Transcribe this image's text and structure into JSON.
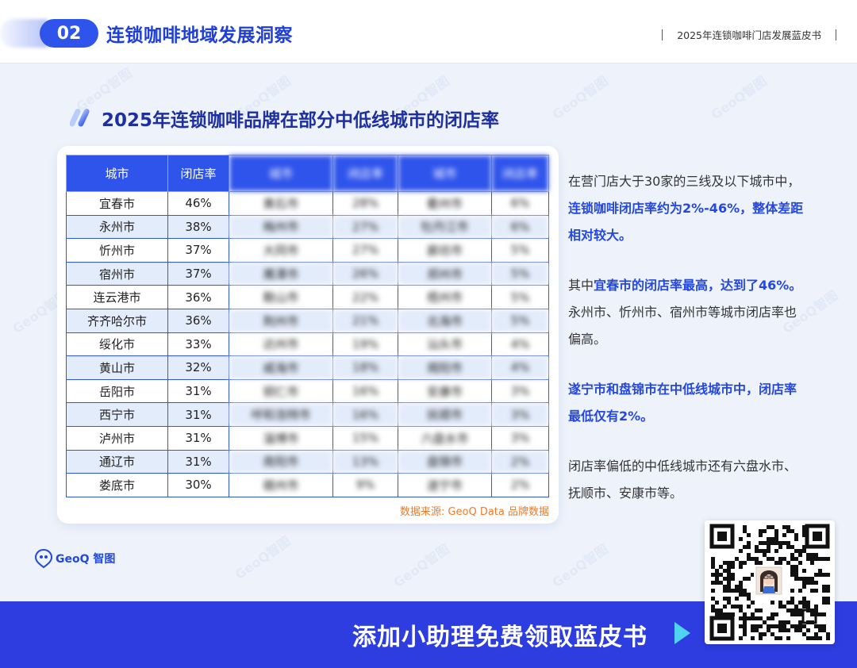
{
  "header": {
    "section_number": "02",
    "section_title": "连锁咖啡地域发展洞察",
    "report_title": "2025年连锁咖啡门店发展蓝皮书"
  },
  "section": {
    "title": "2025年连锁咖啡品牌在部分中低线城市的闭店率"
  },
  "table": {
    "headers": [
      "城市",
      "闭店率",
      "城市",
      "闭店率",
      "城市",
      "闭店率"
    ],
    "rows": [
      {
        "city": "宜春市",
        "rate": "46%",
        "city2": "黄石市",
        "rate2": "28%",
        "city3": "衢州市",
        "rate3": "6%"
      },
      {
        "city": "永州市",
        "rate": "38%",
        "city2": "梅州市",
        "rate2": "27%",
        "city3": "牡丹江市",
        "rate3": "6%"
      },
      {
        "city": "忻州市",
        "rate": "37%",
        "city2": "大同市",
        "rate2": "27%",
        "city3": "廊坊市",
        "rate3": "5%"
      },
      {
        "city": "宿州市",
        "rate": "37%",
        "city2": "鹰潭市",
        "rate2": "26%",
        "city3": "郑州市",
        "rate3": "5%"
      },
      {
        "city": "连云港市",
        "rate": "36%",
        "city2": "鞍山市",
        "rate2": "22%",
        "city3": "梧州市",
        "rate3": "5%"
      },
      {
        "city": "齐齐哈尔市",
        "rate": "36%",
        "city2": "荆州市",
        "rate2": "21%",
        "city3": "北海市",
        "rate3": "5%"
      },
      {
        "city": "绥化市",
        "rate": "33%",
        "city2": "达州市",
        "rate2": "19%",
        "city3": "汕头市",
        "rate3": "4%"
      },
      {
        "city": "黄山市",
        "rate": "32%",
        "city2": "威海市",
        "rate2": "18%",
        "city3": "揭阳市",
        "rate3": "4%"
      },
      {
        "city": "岳阳市",
        "rate": "31%",
        "city2": "铜仁市",
        "rate2": "16%",
        "city3": "安康市",
        "rate3": "3%"
      },
      {
        "city": "西宁市",
        "rate": "31%",
        "city2": "呼和浩特市",
        "rate2": "16%",
        "city3": "抚顺市",
        "rate3": "3%"
      },
      {
        "city": "泸州市",
        "rate": "31%",
        "city2": "淄博市",
        "rate2": "15%",
        "city3": "六盘水市",
        "rate3": "3%"
      },
      {
        "city": "通辽市",
        "rate": "31%",
        "city2": "南阳市",
        "rate2": "13%",
        "city3": "盘锦市",
        "rate3": "2%"
      },
      {
        "city": "娄底市",
        "rate": "30%",
        "city2": "赣州市",
        "rate2": "9%",
        "city3": "遂宁市",
        "rate3": "2%"
      }
    ],
    "source": "数据来源: GeoQ Data 品牌数据"
  },
  "insights": {
    "p1_a": "在营门店大于30家的三线及以下城市中，",
    "p1_b": "连锁咖啡闭店率约为2%-46%，整体差距相对较大。",
    "p2_a": "其中",
    "p2_b": "宜春市的闭店率最高，达到了46%。",
    "p2_c": "永州市、忻州市、宿州市等城市闭店率也偏高。",
    "p3": "遂宁市和盘锦市在中低线城市中，闭店率最低仅有2%。",
    "p4": "闭店率偏低的中低线城市还有六盘水市、抚顺市、安康市等。"
  },
  "logo": {
    "text": "GeoQ 智图",
    "icon": "geoq-pin-icon"
  },
  "banner": {
    "text": "添加小助理免费领取蓝皮书",
    "icon": "play-arrow-icon"
  },
  "watermark": "GeoQ智图",
  "colors": {
    "primary": "#2f54eb",
    "banner": "#2d3de0",
    "highlight": "#2447e0",
    "source": "#f07a2a",
    "row_alt": "#e3ecfb"
  }
}
